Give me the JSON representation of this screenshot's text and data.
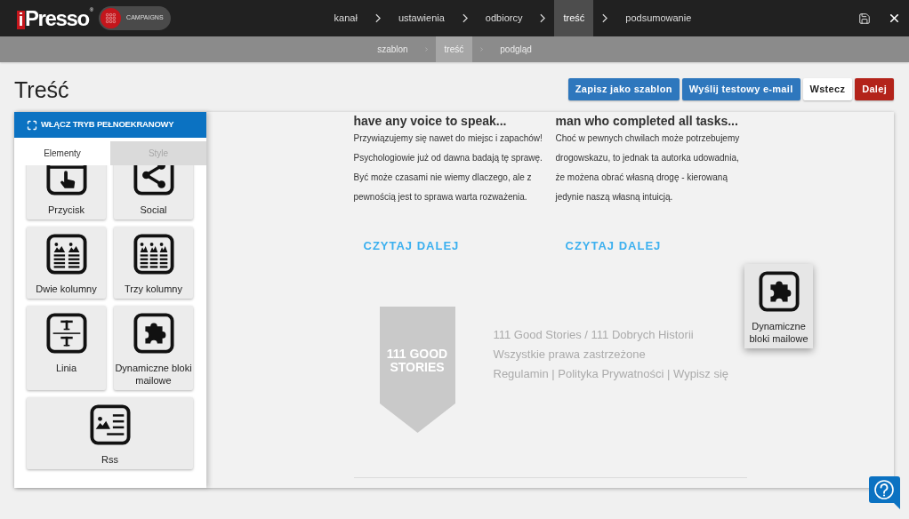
{
  "header": {
    "logo": {
      "mark": "i",
      "name": "Presso",
      "registered": "®"
    },
    "product_badge": "CAMPAIGNS",
    "steps": [
      {
        "label": "kanał",
        "selected": false
      },
      {
        "label": "ustawienia",
        "selected": false
      },
      {
        "label": "odbiorcy",
        "selected": false
      },
      {
        "label": "treść",
        "selected": true
      },
      {
        "label": "podsumowanie",
        "selected": false
      }
    ]
  },
  "substeps": [
    {
      "label": "szablon",
      "selected": false
    },
    {
      "label": "treść",
      "selected": true
    },
    {
      "label": "podgląd",
      "selected": false
    }
  ],
  "page_title": "Treść",
  "actions": [
    {
      "label": "Zapisz jako szablon",
      "kind": "primary"
    },
    {
      "label": "Wyślij testowy e-mail",
      "kind": "primary"
    },
    {
      "label": "Wstecz",
      "kind": "secondary"
    },
    {
      "label": "Dalej",
      "kind": "danger"
    }
  ],
  "editor_panel": {
    "fullscreen_button": "WŁĄCZ TRYB PEŁNOEKRANOWY",
    "tabs": [
      {
        "label": "Elementy",
        "selected": true
      },
      {
        "label": "Style",
        "selected": false
      }
    ],
    "elements": [
      {
        "label": "Przycisk",
        "kind": "button"
      },
      {
        "label": "Social",
        "kind": "social"
      },
      {
        "label": "Dwie kolumny",
        "kind": "two-columns"
      },
      {
        "label": "Trzy kolumny",
        "kind": "three-columns"
      },
      {
        "label": "Linia",
        "kind": "divider"
      },
      {
        "label": "Dynamiczne bloki mailowe",
        "kind": "dynamic-blocks"
      },
      {
        "label": "Rss",
        "kind": "rss"
      }
    ]
  },
  "email_preview": {
    "columns": [
      {
        "heading": "have any voice to speak...",
        "text": "Przywiązujemy się nawet do miejsc i zapachów! Psychologiowie już od dawna badają tę sprawę. Być może czasami nie wiemy dlaczego, ale z pewnością jest to sprawa warta rozważenia.",
        "link": "CZYTAJ DALEJ"
      },
      {
        "heading": "man who completed all tasks...",
        "text": "Choć w pewnych chwilach może potrzebujemy drogowskazu, to jednak ta autorka udowadnia, że możena obrać własną drogę - kierowaną jedynie naszą własną intuicją.",
        "link": "CZYTAJ DALEJ"
      }
    ],
    "footer": {
      "logo_text": "111 GOOD STORIES",
      "lines": [
        "111 Good Stories / 111 Dobrych Historii",
        "Wszystkie prawa zastrzeżone",
        "Regulamin | Polityka Prywatności | Wypisz się"
      ]
    }
  },
  "drag_preview": {
    "label": "Dynamiczne bloki mailowe",
    "kind": "dynamic-blocks"
  }
}
